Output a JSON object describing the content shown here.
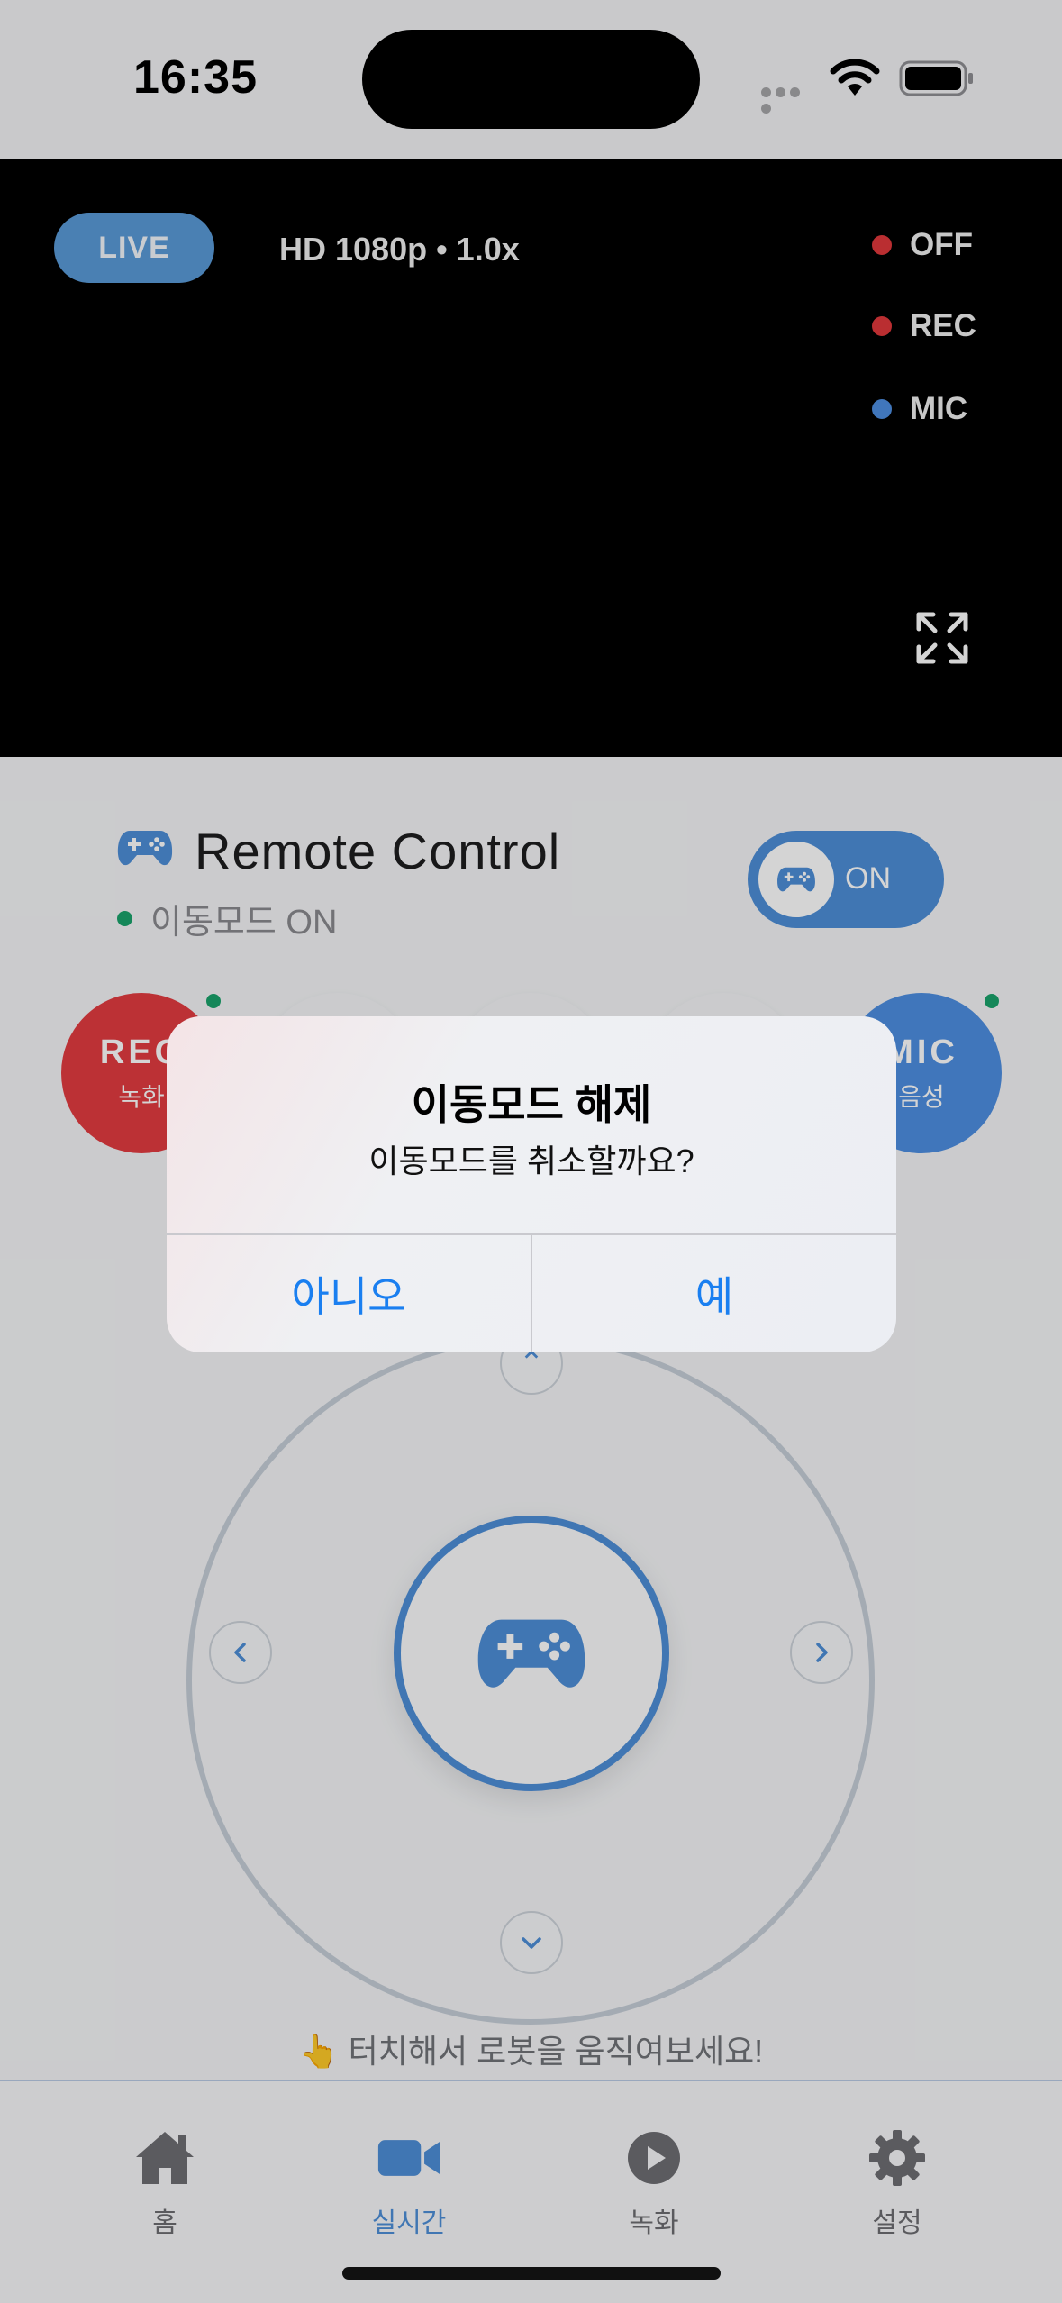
{
  "status_bar": {
    "time": "16:35"
  },
  "video": {
    "live_label": "LIVE",
    "quality": "HD 1080p • 1.0x",
    "indicators": [
      {
        "label": "OFF",
        "color": "#e0383c"
      },
      {
        "label": "REC",
        "color": "#e0383c"
      },
      {
        "label": "MIC",
        "color": "#4d8ee1"
      }
    ],
    "expand_icon": "expand-icon"
  },
  "remote": {
    "title": "Remote Control",
    "status": "이동모드 ON",
    "toggle_label": "ON",
    "rec": {
      "label": "REC",
      "sub": "녹화"
    },
    "mic": {
      "label": "MIC",
      "sub": "음성"
    },
    "hint": "👆 터치해서 로봇을 움직여보세요!"
  },
  "alert": {
    "title": "이동모드 해제",
    "message": "이동모드를 취소할까요?",
    "cancel": "아니오",
    "confirm": "예"
  },
  "tabs": [
    {
      "label": "홈",
      "icon": "home-icon",
      "active": false
    },
    {
      "label": "실시간",
      "icon": "video-camera-icon",
      "active": true
    },
    {
      "label": "녹화",
      "icon": "play-icon",
      "active": false
    },
    {
      "label": "설정",
      "icon": "gear-icon",
      "active": false
    }
  ],
  "colors": {
    "accent": "#4e8fd8",
    "rec": "#e23b40",
    "online": "#1aa36b",
    "alert_button": "#1a7ff0"
  }
}
